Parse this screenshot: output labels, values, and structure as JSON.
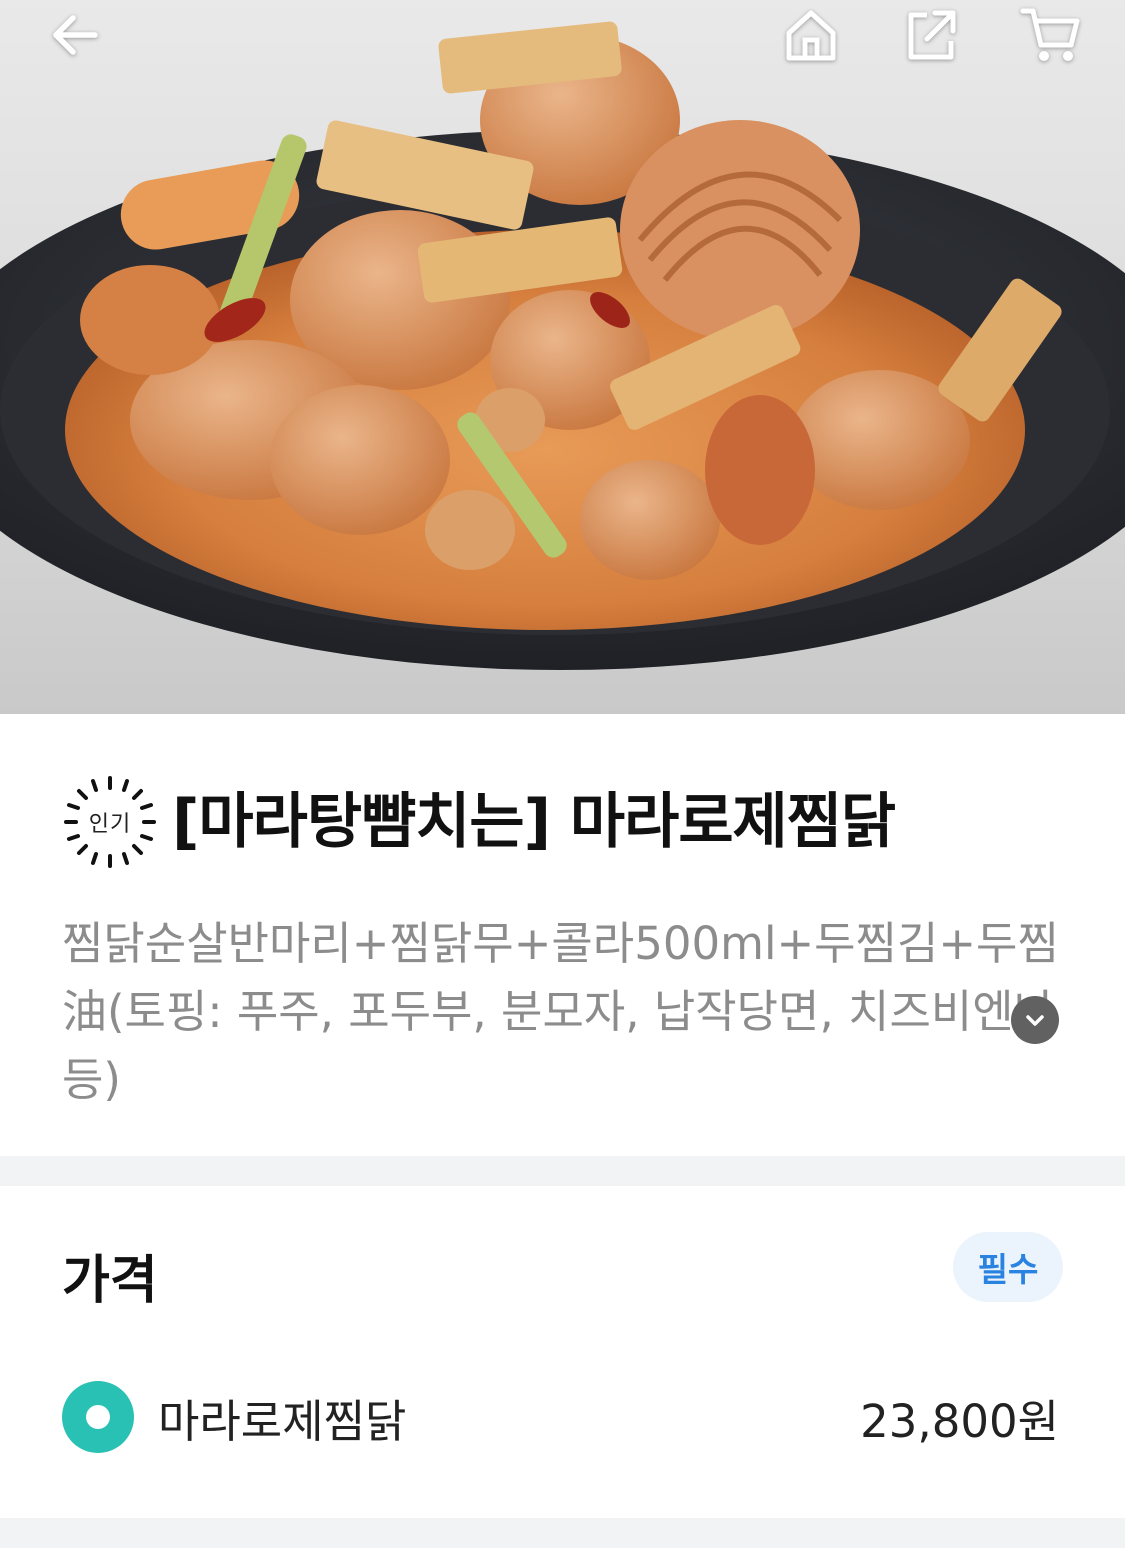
{
  "header": {
    "icons": [
      "back-arrow-icon",
      "home-icon",
      "share-icon",
      "cart-icon"
    ]
  },
  "product": {
    "badge": "인기",
    "title": "[마라탕뺨치는] 마라로제찜닭",
    "description": "찜닭순살반마리+찜닭무+콜라500ml+두찜김+두찜油(토핑: 푸주, 포두부, 분모자, 납작당면, 치즈비엔나 등)"
  },
  "price_section": {
    "title": "가격",
    "required_label": "필수",
    "options": [
      {
        "label": "마라로제찜닭",
        "price": "23,800원",
        "selected": true
      }
    ]
  },
  "colors": {
    "accent_teal": "#28c1b3",
    "required_blue": "#2a83e0",
    "required_bg": "#ebf4fd",
    "divider": "#f2f3f5",
    "description_gray": "#8c8c8c"
  }
}
